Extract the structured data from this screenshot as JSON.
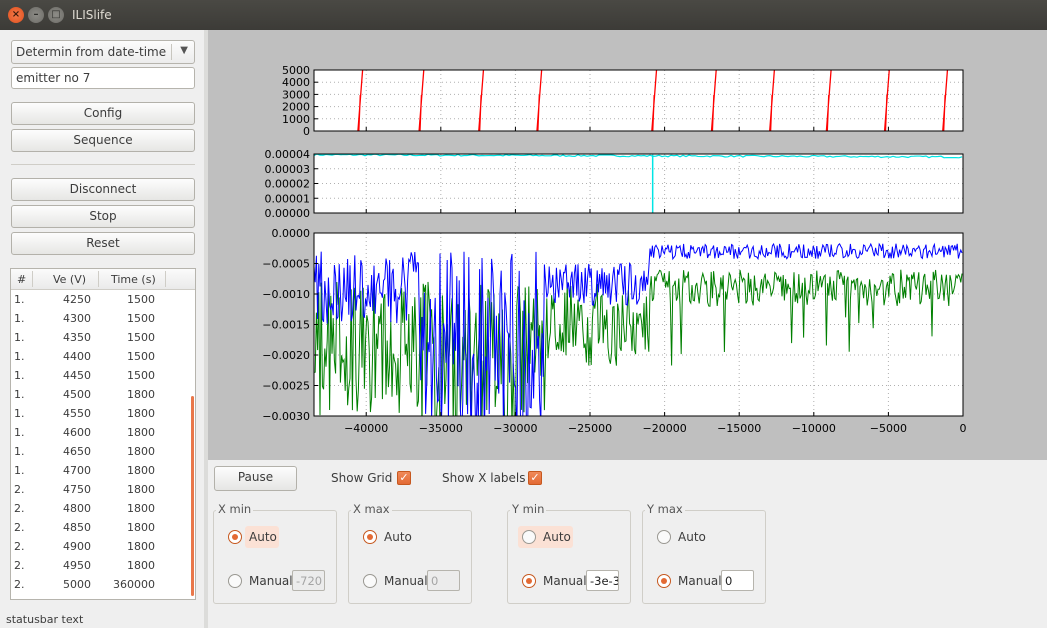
{
  "window": {
    "title": "ILISlife"
  },
  "left": {
    "mode_combo": "Determin from date-time",
    "emitter_field": "emitter no 7",
    "buttons": {
      "config": "Config",
      "sequence": "Sequence",
      "disconnect": "Disconnect",
      "stop": "Stop",
      "reset": "Reset"
    },
    "table": {
      "headers": [
        "#",
        "Ve (V)",
        "Time (s)"
      ],
      "rows": [
        [
          "1.",
          "4250",
          "1500"
        ],
        [
          "1.",
          "4300",
          "1500"
        ],
        [
          "1.",
          "4350",
          "1500"
        ],
        [
          "1.",
          "4400",
          "1500"
        ],
        [
          "1.",
          "4450",
          "1500"
        ],
        [
          "1.",
          "4500",
          "1800"
        ],
        [
          "1.",
          "4550",
          "1800"
        ],
        [
          "1.",
          "4600",
          "1800"
        ],
        [
          "1.",
          "4650",
          "1800"
        ],
        [
          "1.",
          "4700",
          "1800"
        ],
        [
          "2.",
          "4750",
          "1800"
        ],
        [
          "2.",
          "4800",
          "1800"
        ],
        [
          "2.",
          "4850",
          "1800"
        ],
        [
          "2.",
          "4900",
          "1800"
        ],
        [
          "2.",
          "4950",
          "1800"
        ],
        [
          "2.",
          "5000",
          "360000"
        ]
      ]
    }
  },
  "statusbar": "statusbar text",
  "controls": {
    "pause": "Pause",
    "show_grid": "Show Grid",
    "show_xlabels": "Show X labels",
    "auto_label": "Auto",
    "manual_label": "Manual",
    "groups": {
      "xmin": {
        "title": "X min",
        "value": "-720"
      },
      "xmax": {
        "title": "X max",
        "value": "0"
      },
      "ymin": {
        "title": "Y min",
        "value": "-3e-3"
      },
      "ymax": {
        "title": "Y max",
        "value": "0"
      }
    }
  },
  "colors": {
    "accent": "#e36a34",
    "red": "#ff0000",
    "cyan": "#00e5e5",
    "blue": "#0000ff",
    "green": "#007f00"
  },
  "chart_data": [
    {
      "type": "line",
      "xlim": [
        -43500,
        0
      ],
      "ylim": [
        0,
        5000
      ],
      "yticks": [
        "5000",
        "4000",
        "3000",
        "2000",
        "1000",
        "0"
      ],
      "grid": true,
      "series": [
        {
          "color": "#ff0000",
          "sawtooth_resets_x": [
            -40500,
            -36400,
            -32400,
            -28500,
            -20800,
            -16800,
            -12900,
            -9100,
            -5200,
            -1300
          ]
        }
      ]
    },
    {
      "type": "line",
      "xlim": [
        -43500,
        0
      ],
      "ylim": [
        0,
        4e-05
      ],
      "yticks": [
        "0.00004",
        "0.00003",
        "0.00002",
        "0.00001",
        "0.00000"
      ],
      "grid": true,
      "series": [
        {
          "color": "#00e5e5",
          "level": 3.95e-05,
          "dropout_x": -20800
        }
      ]
    },
    {
      "type": "line",
      "xlim": [
        -43500,
        0
      ],
      "ylim": [
        -0.003,
        0
      ],
      "yticks": [
        "0.0000",
        "−0.0005",
        "−0.0010",
        "−0.0015",
        "−0.0020",
        "−0.0025",
        "−0.0030"
      ],
      "xticks": [
        "−40000",
        "−35000",
        "−30000",
        "−25000",
        "−20000",
        "−15000",
        "−10000",
        "−5000",
        "0"
      ],
      "grid": true,
      "series": [
        {
          "color": "#0000ff",
          "approx_level": -0.0003
        },
        {
          "color": "#007f00",
          "approx_level": -0.0009
        }
      ]
    }
  ]
}
